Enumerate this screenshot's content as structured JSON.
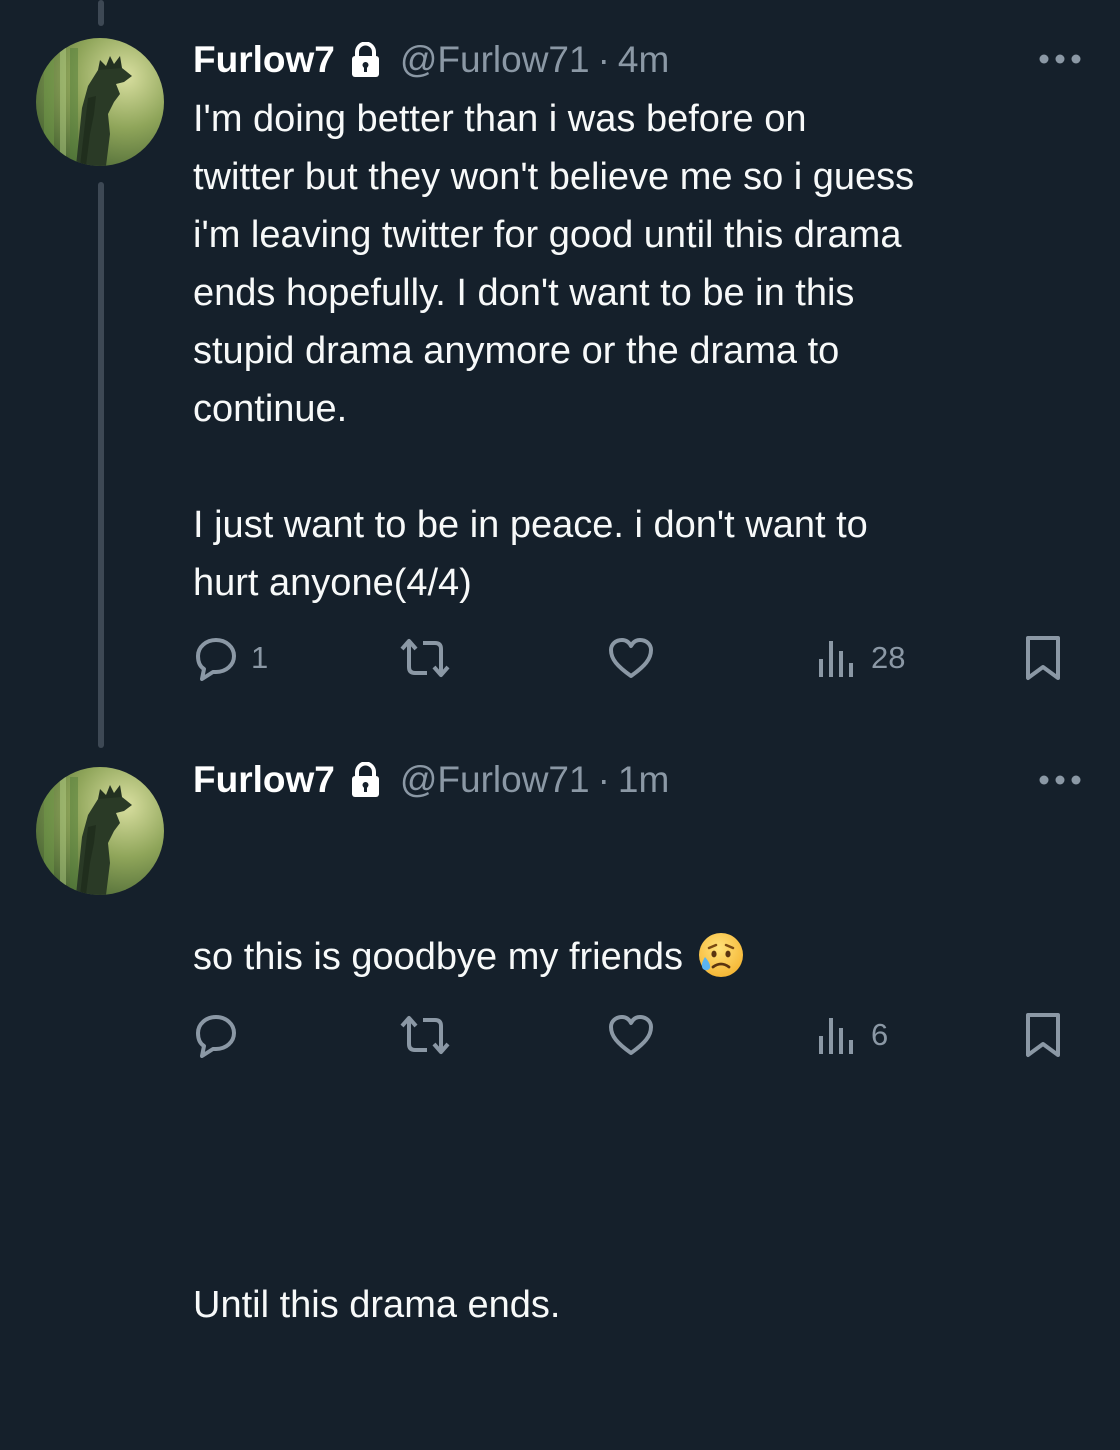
{
  "tweets": [
    {
      "display_name": "Furlow7",
      "handle": "@Furlow71",
      "separator": "·",
      "time": "4m",
      "text": "I'm doing better than i was before on\ntwitter but they won't believe me so i guess\ni'm leaving twitter for good until this drama\nends hopefully. I don't want to be in this\nstupid drama anymore or the drama to\ncontinue.\n\nI just want to be in peace. i don't want to\nhurt anyone(4/4)",
      "reply_count": "1",
      "retweet_count": "",
      "like_count": "",
      "view_count": "28"
    },
    {
      "display_name": "Furlow7",
      "handle": "@Furlow71",
      "separator": "·",
      "time": "1m",
      "text_line1": "so this is goodbye my friends",
      "emoji": "sad-but-relieved-face",
      "text_line2": "Until this drama ends.",
      "reply_count": "",
      "retweet_count": "",
      "like_count": "",
      "view_count": "6"
    }
  ],
  "icons": {
    "lock": "lock-icon",
    "more": "more-icon",
    "reply": "reply-icon",
    "retweet": "retweet-icon",
    "like": "like-icon",
    "views": "views-icon",
    "bookmark": "bookmark-icon"
  },
  "colors": {
    "background": "#15202b",
    "text": "#f7f9f9",
    "secondary": "#8b98a5",
    "thread_line": "#3d4854"
  }
}
